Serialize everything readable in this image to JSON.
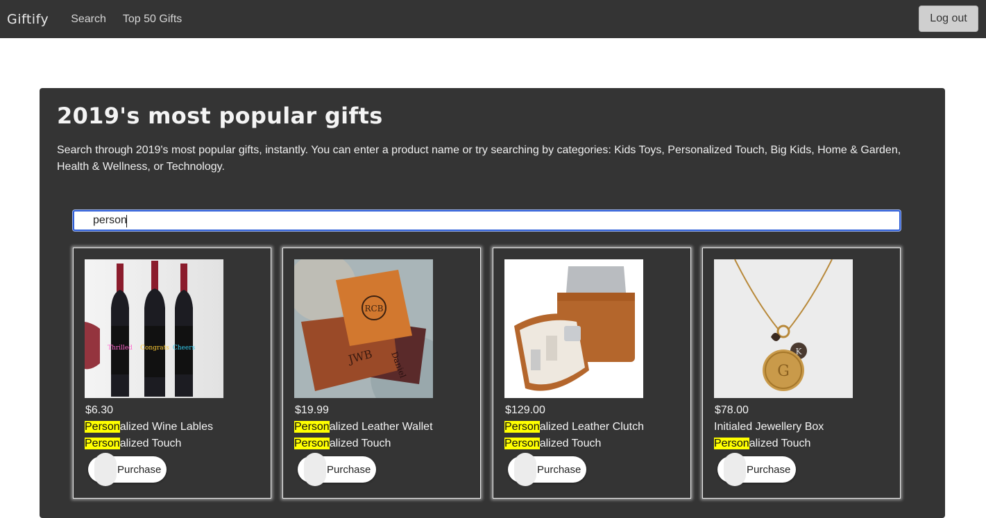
{
  "nav": {
    "brand": "Giftify",
    "links": [
      "Search",
      "Top 50 Gifts"
    ],
    "logout_label": "Log out"
  },
  "hero": {
    "title": "2019's most popular gifts",
    "description": "Search through 2019's most popular gifts, instantly. You can enter a product name or try searching by categories: Kids Toys, Personalized Touch, Big Kids, Home & Garden, Health & Wellness, or Technology."
  },
  "search": {
    "value": "person",
    "placeholder": ""
  },
  "results": [
    {
      "price": "$6.30",
      "name_highlight": "Person",
      "name_rest": "alized Wine Lables",
      "cat_highlight": "Person",
      "cat_rest": "alized Touch",
      "image": "wine-bottles-image",
      "purchase_label": "Purchase"
    },
    {
      "price": "$19.99",
      "name_highlight": "Person",
      "name_rest": "alized Leather Wallet",
      "cat_highlight": "Person",
      "cat_rest": "alized Touch",
      "image": "leather-wallet-image",
      "purchase_label": "Purchase"
    },
    {
      "price": "$129.00",
      "name_highlight": "Person",
      "name_rest": "alized Leather Clutch",
      "cat_highlight": "Person",
      "cat_rest": "alized Touch",
      "image": "leather-clutch-image",
      "purchase_label": "Purchase"
    },
    {
      "price": "$78.00",
      "name_highlight": "",
      "name_rest": "Initialed Jewellery Box",
      "cat_highlight": "Person",
      "cat_rest": "alized Touch",
      "image": "charm-necklace-image",
      "purchase_label": "Purchase"
    }
  ],
  "colors": {
    "navbar": "#343434",
    "panel": "#343434",
    "highlight": "#ffff00",
    "search_border": "#2f5fd8"
  }
}
